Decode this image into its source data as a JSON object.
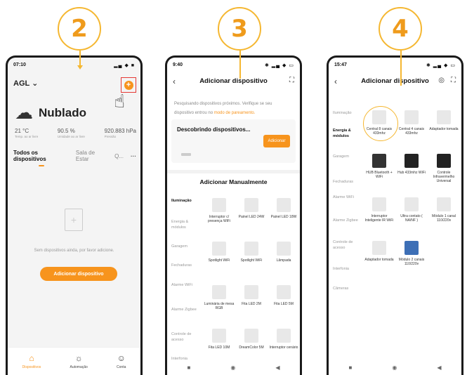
{
  "steps": [
    "2",
    "3",
    "4"
  ],
  "screen2": {
    "time": "07:10",
    "status_icons": "▂▄ ◆ ■",
    "home": "AGL",
    "weather": "Nublado",
    "stats": [
      {
        "value": "21 °C",
        "label": "Temp. ao ar livre"
      },
      {
        "value": "90.5 %",
        "label": "Umidade ao ar livre"
      },
      {
        "value": "920.883 hPa",
        "label": "Pressão"
      }
    ],
    "tabs": [
      "Todos os dispositivos",
      "Sala de Estar",
      "Q..."
    ],
    "empty_text": "Sem dispositivos ainda, por favor adicione.",
    "add_button": "Adicionar dispositivo",
    "nav": [
      "Dispositivos",
      "Automação",
      "Conta"
    ]
  },
  "screen3": {
    "time": "9:40",
    "status_icons": "✱ ▂▄ ◆ ▭",
    "title": "Adicionar dispositivo",
    "search_text": "Pesquisando dispositivos próximos. Verifique se seu dispositivo entrou no",
    "search_link": "modo de pareamento.",
    "discover_title": "Descobrindo dispositivos...",
    "discover_button": "Adicionar",
    "manual_title": "Adicionar Manualmente",
    "categories": [
      "Iluminação",
      "Energia & módulos",
      "Garagem",
      "Fechaduras",
      "Alarme WiFi",
      "Alarme Zigbee",
      "Controle de acesso",
      "Interfonia"
    ],
    "devices": [
      "Interruptor c/ presença WiFi",
      "Painel LED 24W",
      "Painel LED 18W",
      "Spotlight WiFi",
      "Spotlight WiFi",
      "Lâmpada",
      "Luminária de mesa RGB",
      "Fita LED 2M",
      "Fita LED 5M",
      "Fita LED 10M",
      "DreamColor 5M",
      "Interruptor cenário"
    ]
  },
  "screen4": {
    "time": "15:47",
    "status_icons": "✱ ▂▄ ◆ ▭",
    "title": "Adicionar dispositivo",
    "categories": [
      "Iluminação",
      "Energia & módulos",
      "Garagem",
      "Fechaduras",
      "Alarme WiFi",
      "Alarme Zigbee",
      "Controle de acesso",
      "Interfonia",
      "Câmeras"
    ],
    "devices": [
      "Central 8 canais 433mhz",
      "Central 4 canais 433mhz",
      "Adaptador tomada",
      "HUB Bluetooth + WiFi",
      "Hub 433mhz WiFi",
      "Controle Infravermelho Universal",
      "Interruptor Inteligente IR WiFi",
      "Ultra contato ( NA/NF )",
      "Módulo 1 canal 110/220v",
      "Adaptador tomada",
      "Módulo 2 canais 110/220v"
    ]
  },
  "system_nav": [
    "■",
    "◉",
    "◀"
  ]
}
